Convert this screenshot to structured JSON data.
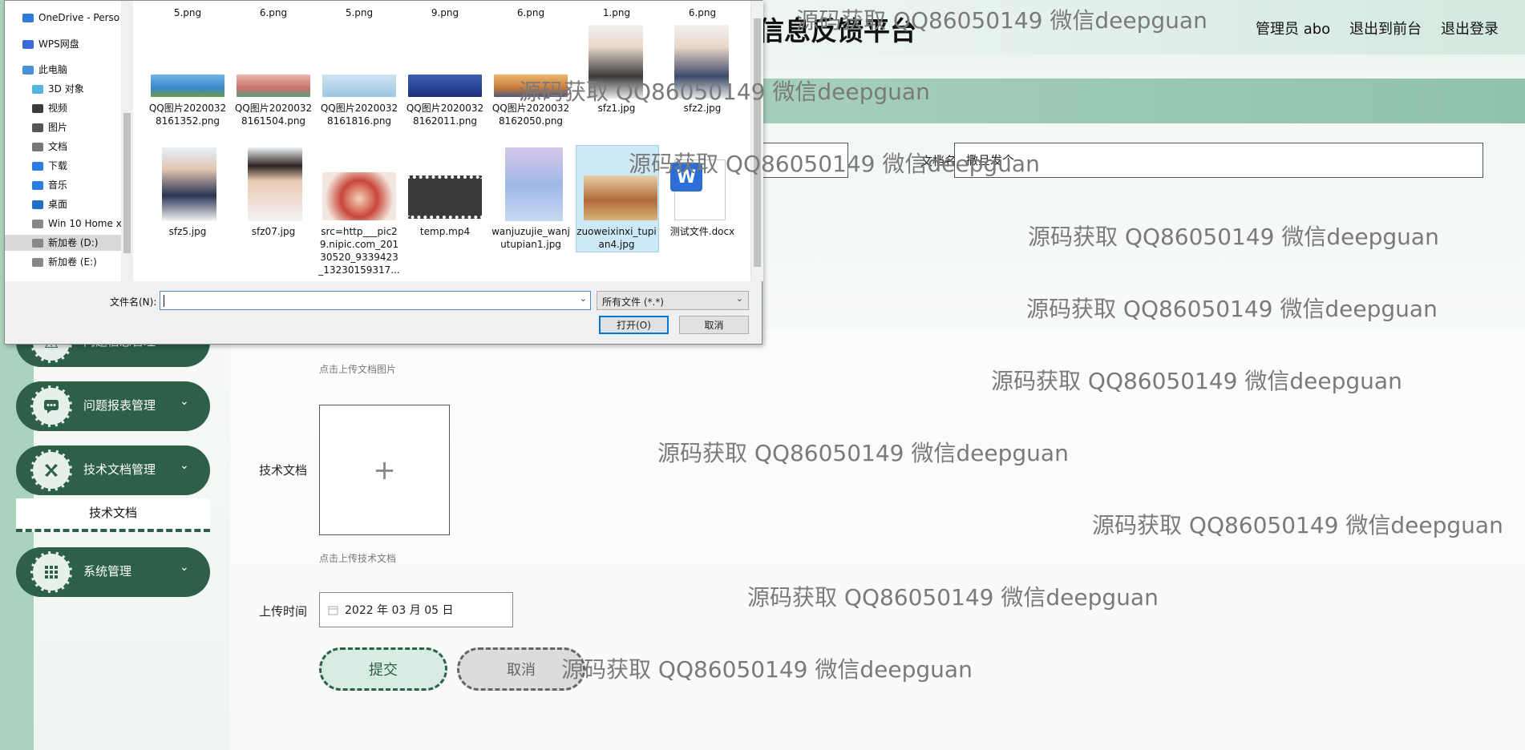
{
  "site": {
    "title": "信息反馈平台",
    "links": [
      "管理员 abo",
      "退出到前台",
      "退出登录"
    ]
  },
  "sidebar": {
    "items": [
      {
        "label": "问题信息管理",
        "icon": "warning-icon"
      },
      {
        "label": "问题报表管理",
        "icon": "chat-icon"
      },
      {
        "label": "技术文档管理",
        "icon": "tools-icon"
      },
      {
        "label": "系统管理",
        "icon": "grid-icon"
      }
    ],
    "submenu_label": "技术文档"
  },
  "form": {
    "doc_name_label": "文档名称",
    "doc_name_value": "撒旦发个",
    "image_hint": "点击上传文档图片",
    "file_label": "技术文档",
    "file_hint": "点击上传技术文档",
    "upload_plus": "+",
    "upload_time_label": "上传时间",
    "upload_time_value": "2022 年 03 月 05 日",
    "submit_label": "提交",
    "cancel_label": "取消"
  },
  "watermark": "源码获取 QQ86050149 微信deepguan",
  "dialog": {
    "nav": [
      {
        "label": "OneDrive - Perso",
        "icon": "cloud-icon"
      },
      {
        "label": "WPS网盘",
        "icon": "cloud-icon"
      },
      {
        "label": "此电脑",
        "icon": "computer-icon"
      },
      {
        "label": "3D 对象",
        "icon": "cube-icon"
      },
      {
        "label": "视频",
        "icon": "video-icon"
      },
      {
        "label": "图片",
        "icon": "picture-icon"
      },
      {
        "label": "文档",
        "icon": "document-icon"
      },
      {
        "label": "下载",
        "icon": "download-icon"
      },
      {
        "label": "音乐",
        "icon": "music-icon"
      },
      {
        "label": "桌面",
        "icon": "desktop-icon"
      },
      {
        "label": "Win 10 Home x",
        "icon": "drive-icon"
      },
      {
        "label": "新加卷 (D:)",
        "icon": "drive-icon"
      },
      {
        "label": "新加卷 (E:)",
        "icon": "drive-icon"
      }
    ],
    "top_row": [
      "5.png",
      "6.png",
      "5.png",
      "9.png",
      "6.png",
      "1.png",
      "6.png"
    ],
    "row2": [
      "QQ图片20200328161352.png",
      "QQ图片20200328161504.png",
      "QQ图片20200328161816.png",
      "QQ图片20200328162011.png",
      "QQ图片20200328162050.png",
      "sfz1.jpg",
      "sfz2.jpg"
    ],
    "row3": [
      "sfz5.jpg",
      "sfz07.jpg",
      "src=http___pic29.nipic.com_20130520_9339423_13230159317...",
      "temp.mp4",
      "wanjuzujie_wanjutupian1.jpg",
      "zuoweixinxi_tupian4.jpg",
      "测试文件.docx"
    ],
    "filename_label": "文件名(N):",
    "filename_value": "",
    "filetype_value": "所有文件 (*.*)",
    "open_label": "打开(O)",
    "cancel_label": "取消"
  },
  "colors": {
    "brand": "#2d5f49",
    "accent": "#a9d2bf"
  }
}
